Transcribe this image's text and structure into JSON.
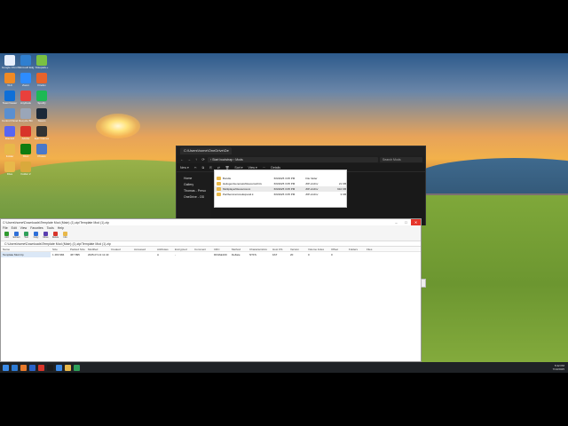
{
  "desktop": {
    "icons": [
      {
        "label": "Google Chrome",
        "color": "#e8f0fe"
      },
      {
        "label": "Microsoft Edge",
        "color": "#2f7fd0"
      },
      {
        "label": "Notepad++",
        "color": "#7ac142"
      },
      {
        "label": "VLC",
        "color": "#f08a24"
      },
      {
        "label": "Zoom",
        "color": "#2d8cff"
      },
      {
        "label": "Firefox",
        "color": "#e8632b"
      },
      {
        "label": "TeamViewer",
        "color": "#0e6fd8"
      },
      {
        "label": "AnyDesk",
        "color": "#e8403c"
      },
      {
        "label": "Spotify",
        "color": "#1db954"
      },
      {
        "label": "Control Panel",
        "color": "#5a8fd0"
      },
      {
        "label": "Recycle Bin",
        "color": "#9aa6b8"
      },
      {
        "label": "Steam",
        "color": "#1b2838"
      },
      {
        "label": "Discord",
        "color": "#5865f2"
      },
      {
        "label": "Adobe",
        "color": "#d8352a"
      },
      {
        "label": "Epic Games",
        "color": "#333333"
      },
      {
        "label": "Folder",
        "color": "#e8b84a"
      },
      {
        "label": "Xbox",
        "color": "#107c10"
      },
      {
        "label": "Photos",
        "color": "#4a78c8"
      },
      {
        "label": "Files",
        "color": "#e8b84a"
      },
      {
        "label": "Folder 2",
        "color": "#d9a93c"
      }
    ]
  },
  "explorer": {
    "tab_title": "C:\\Users\\home\\OneDrive\\De",
    "breadcrumb": "› Start bootstrap › Mods",
    "search_placeholder": "Search Mods",
    "toolbar": [
      "New ▾",
      "✂",
      "⧉",
      "⎘",
      "⇄",
      "🗑",
      "Sort ▾",
      "View ▾",
      "···",
      "Details"
    ],
    "sidebar": [
      "Home",
      "Gallery",
      "Thomas - Perso",
      "OneDrive - OD"
    ],
    "popup_rows": [
      {
        "name": "Bundle",
        "date": "6/9/2025 3:05 PM",
        "type": "File folder",
        "size": ""
      },
      {
        "name": "HeliogenGeneratorResourceKit.k",
        "date": "6/9/2025 3:05 PM",
        "type": "ZIP-Archiv",
        "size": "21 KB"
      },
      {
        "name": "MultiplayerResources.k",
        "date": "6/9/2025 3:05 PM",
        "type": "ZIP-Archiv",
        "size": "910 KB"
      },
      {
        "name": "PartServiceCoreExpand.k",
        "date": "6/9/2025 3:05 PM",
        "type": "ZIP-Archiv",
        "size": "3 KB"
      }
    ]
  },
  "appwin": {
    "title": "C:\\Users\\home\\Downloads\\Template Mod (Main) (1).zip\\Template Mod (1).zip",
    "menu": [
      "File",
      "Edit",
      "View",
      "Favorites",
      "Tools",
      "Help"
    ],
    "tools": [
      {
        "label": "Add",
        "color": "#2e9a2e"
      },
      {
        "label": "Extract",
        "color": "#2e6fd8"
      },
      {
        "label": "Test",
        "color": "#2fa05a"
      },
      {
        "label": "Copy",
        "color": "#2e6fd8"
      },
      {
        "label": "Move",
        "color": "#5a3fb0"
      },
      {
        "label": "Delete",
        "color": "#d8352a"
      },
      {
        "label": "Info",
        "color": "#e8b84a"
      }
    ],
    "path": "C:\\Users\\home\\Downloads\\Template Mod (Main) (1).zip\\Template Mod (1).zip",
    "headers": [
      "Name",
      "Size",
      "Packed Size",
      "Modified",
      "Created",
      "Accessed",
      "Attributes",
      "Encrypted",
      "Comment",
      "CRC",
      "Method",
      "Characteristics",
      "Host OS",
      "Version",
      "Volume Index",
      "Offset",
      "Folders",
      "Files"
    ],
    "row": [
      "Template Mod.zip",
      "1 483 984",
      "467 895",
      "2025-07-13 11:43",
      "",
      "",
      "A",
      "-",
      "",
      "DF0AE100",
      "Deflate",
      "NTFS",
      "FAT",
      "20",
      "0",
      "0",
      "",
      ""
    ]
  },
  "taskbar": {
    "items": [
      "#2d7bd5",
      "#e87a2b",
      "#2a63c8",
      "#d8352a",
      "#1b1b1b",
      "#3b8be8",
      "#e8b84a",
      "#2fa05a"
    ],
    "time": "5:32 PM",
    "date": "7/13/2025"
  }
}
